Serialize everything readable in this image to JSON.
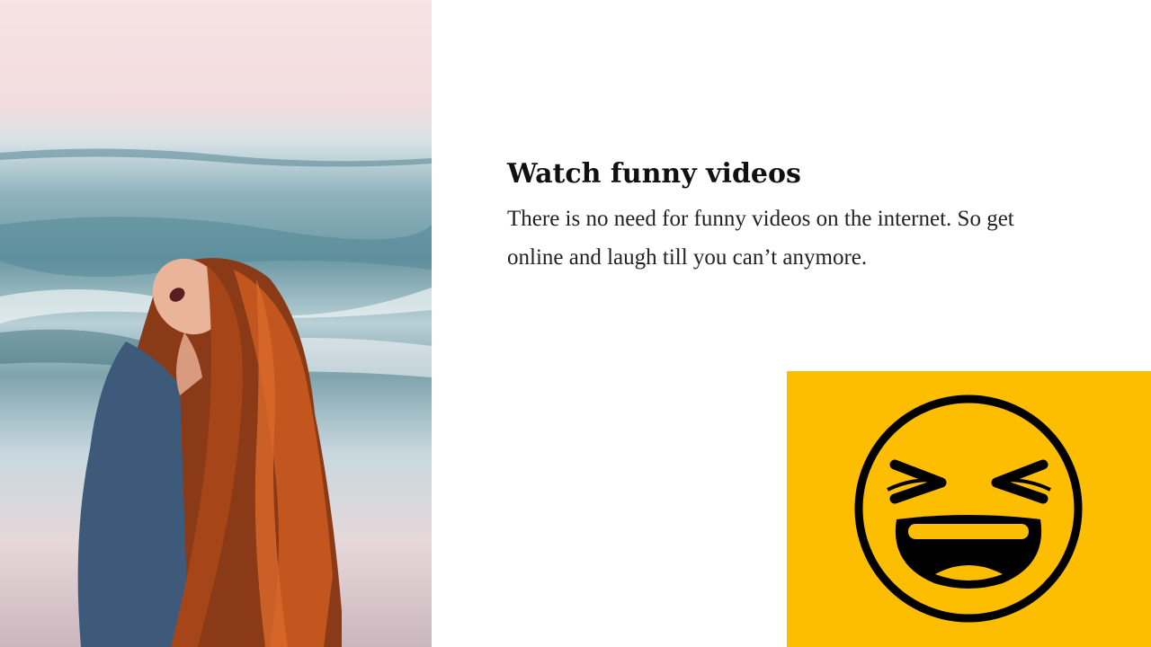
{
  "slide": {
    "title": "Watch funny videos",
    "body": "There is no need for funny videos on the internet. So get online and laugh till you can’t anymore."
  },
  "colors": {
    "accent_yellow": "#fdbd00",
    "text_dark": "#111111",
    "background": "#ffffff"
  },
  "icons": {
    "emoji": "laughing-face-icon",
    "photo": "laughing-woman-beach-photo"
  }
}
